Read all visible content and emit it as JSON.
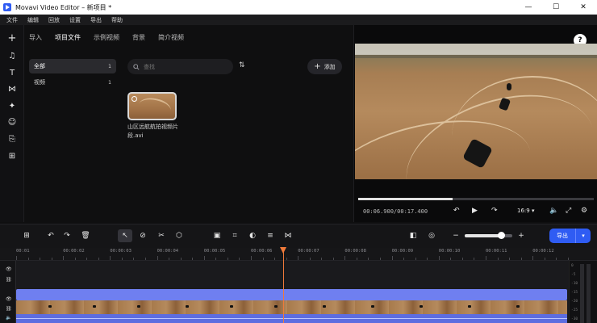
{
  "window": {
    "title": "Movavi Video Editor – 新项目 *",
    "controls": [
      "—",
      "☐",
      "✕"
    ]
  },
  "menu": [
    "文件",
    "编辑",
    "回放",
    "设置",
    "导出",
    "帮助"
  ],
  "left_tools": [
    {
      "name": "add-media",
      "glyph": "+"
    },
    {
      "name": "music",
      "glyph": "♫"
    },
    {
      "name": "text",
      "glyph": "T"
    },
    {
      "name": "transitions",
      "glyph": "⋈"
    },
    {
      "name": "effects",
      "glyph": "✦"
    },
    {
      "name": "stickers",
      "glyph": "☺"
    },
    {
      "name": "more",
      "glyph": "⎘"
    },
    {
      "name": "settings",
      "glyph": "⊞"
    }
  ],
  "tabs": [
    "导入",
    "项目文件",
    "示例视频",
    "背景",
    "简介视频"
  ],
  "active_tab": "项目文件",
  "folders": [
    {
      "label": "全部",
      "count": "1"
    },
    {
      "label": "视频",
      "count": "1"
    }
  ],
  "search": {
    "placeholder": "查找"
  },
  "add_button": {
    "label": "添加"
  },
  "media": [
    {
      "name": "山区远航航拍视频片段.avi"
    }
  ],
  "preview": {
    "timecode_current": "00:06.900",
    "timecode_total": "00:17.400",
    "timecode": "00:06.900/00:17.400",
    "progress": 0.4,
    "aspect": "16:9"
  },
  "timeline": {
    "export_label": "导出",
    "zoom": 0.75,
    "ruler_labels": [
      "00:01",
      "00:00:02",
      "00:00:03",
      "00:00:04",
      "00:00:05",
      "00:00:06",
      "00:00:07",
      "00:00:08",
      "00:00:09",
      "00:00:10",
      "00:00:11",
      "00:00:12"
    ],
    "meter_labels": [
      "0",
      "-5",
      "-10",
      "-15",
      "-20",
      "-25",
      "-30"
    ]
  },
  "colors": {
    "accent": "#2f5cf3",
    "playhead": "#f07a3a",
    "audio_clip": "#6f7ff0"
  }
}
